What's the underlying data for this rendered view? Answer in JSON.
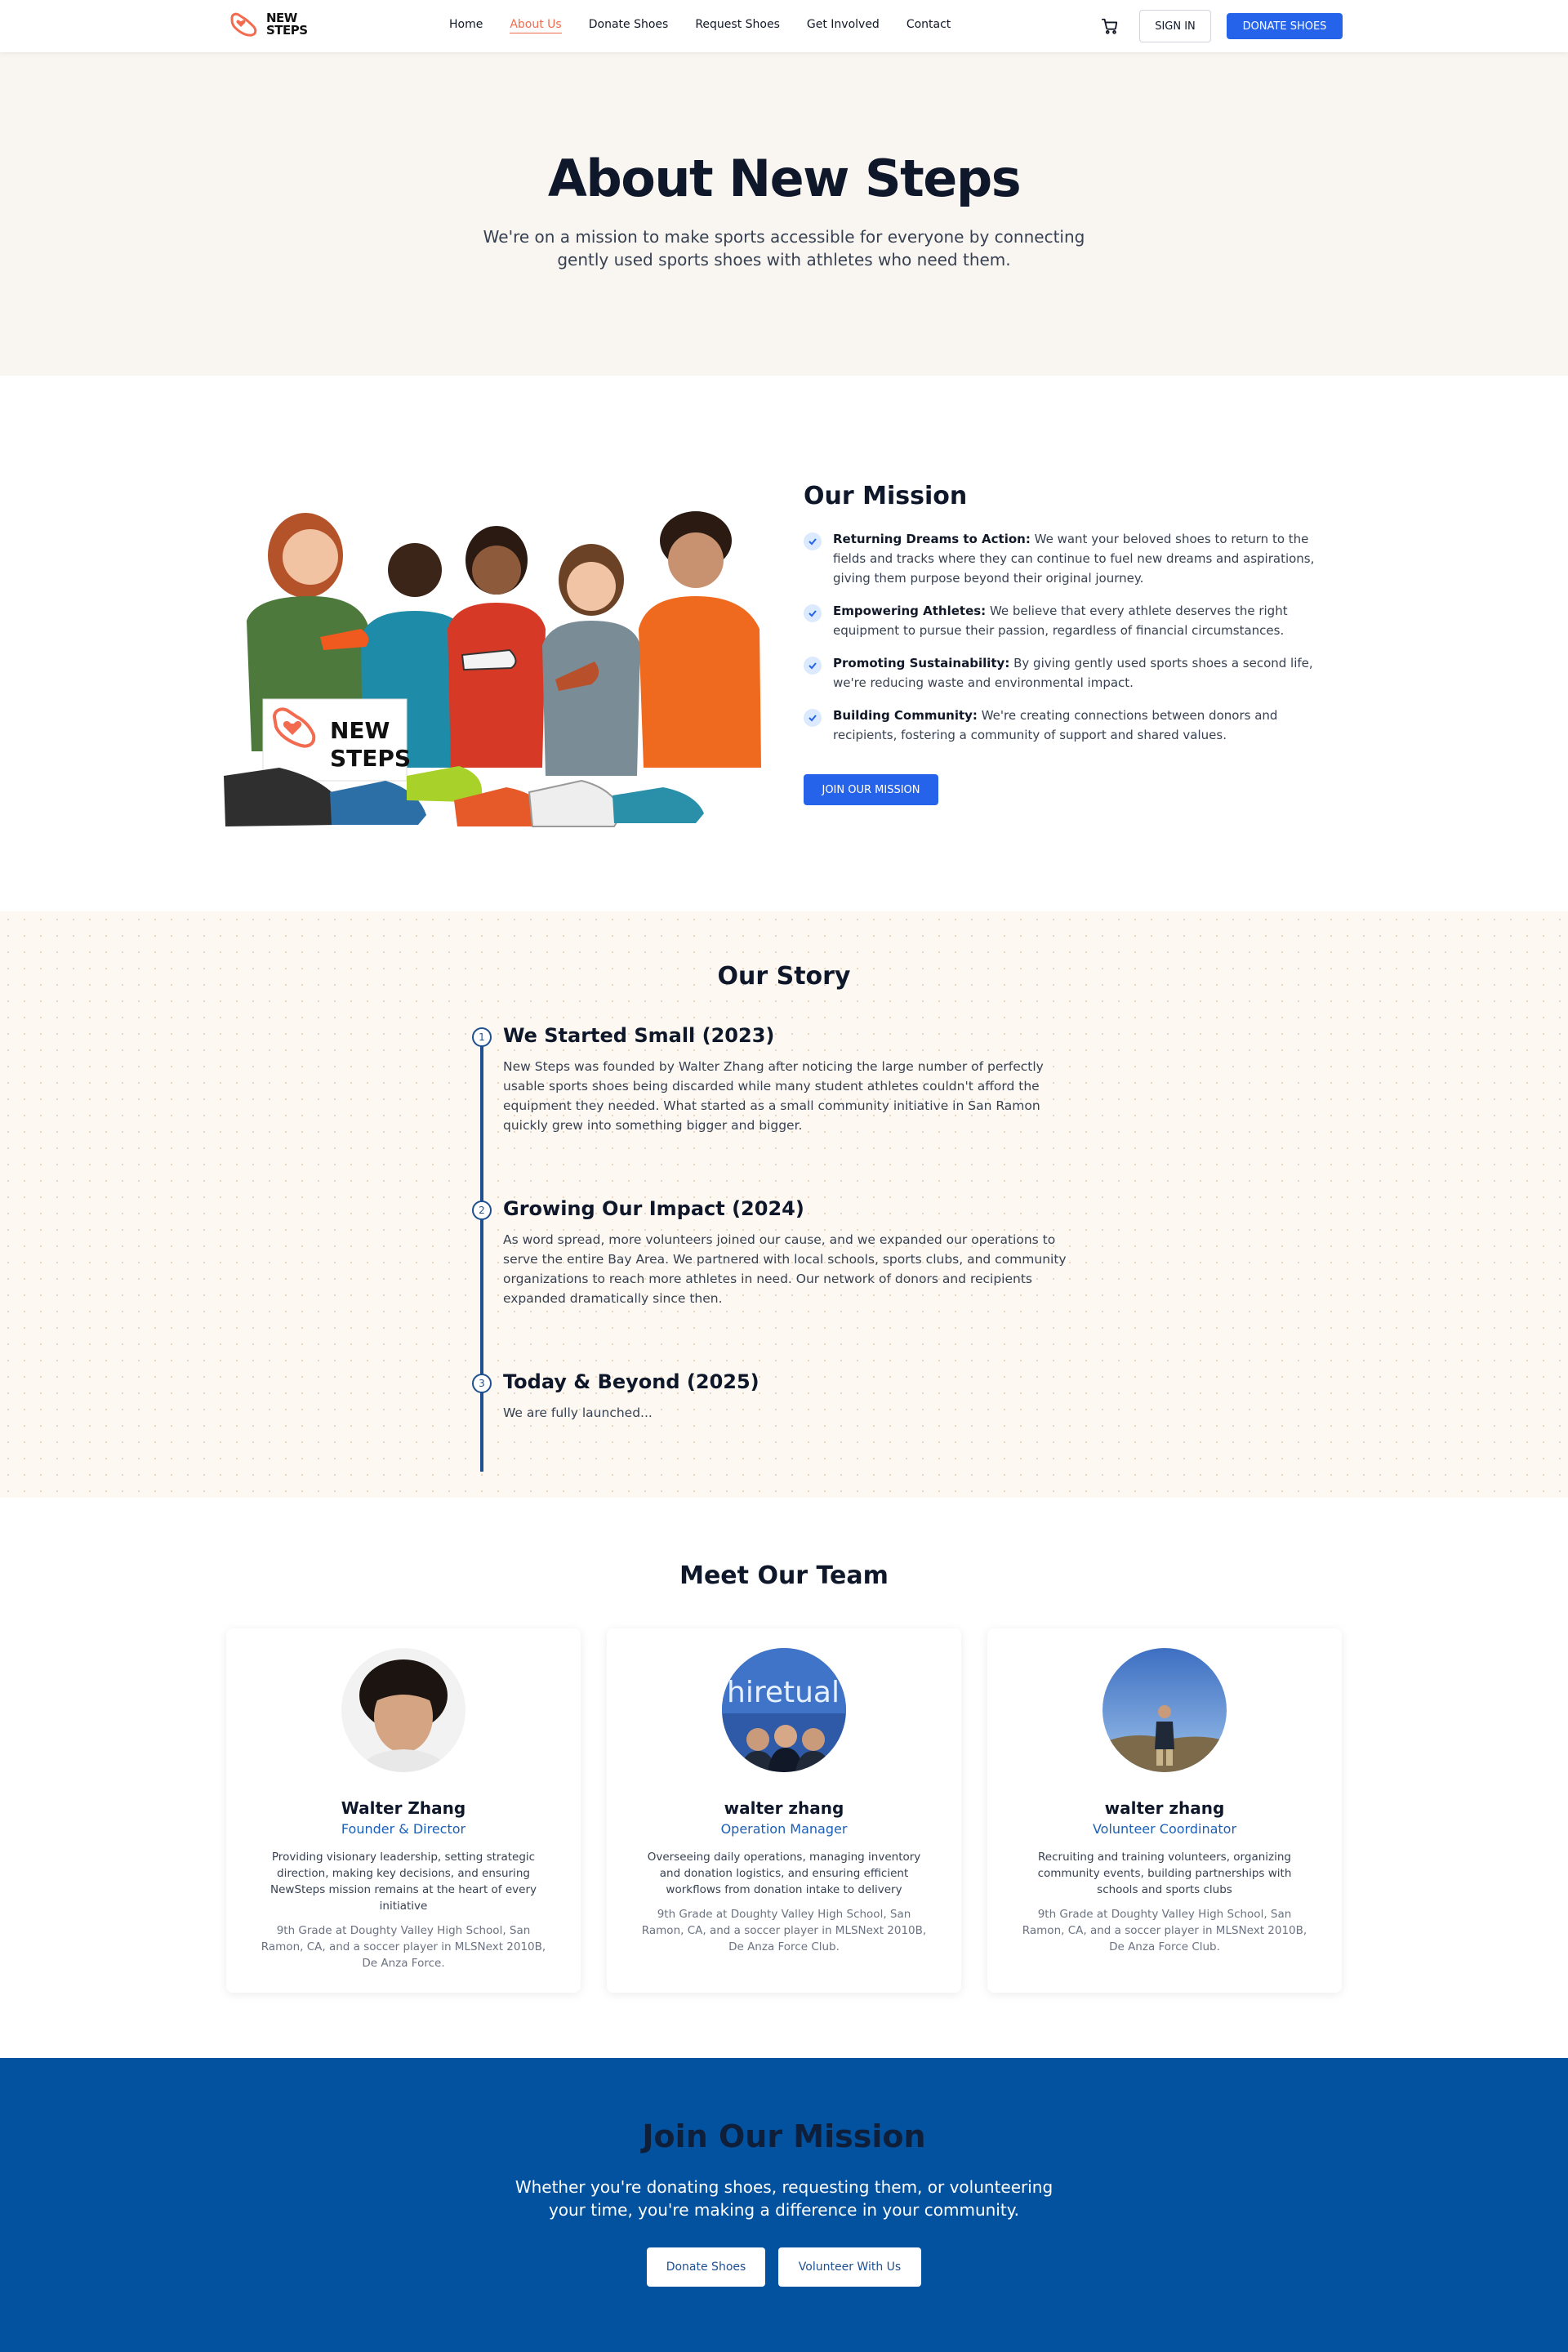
{
  "nav": {
    "logo_line1": "NEW",
    "logo_line2": "STEPS",
    "links": [
      "Home",
      "About Us",
      "Donate Shoes",
      "Request Shoes",
      "Get Involved",
      "Contact"
    ],
    "active_link": "About Us",
    "cart_icon": "cart-icon",
    "sign_in": "SIGN IN",
    "donate": "DONATE SHOES",
    "accent_color": "#2563eb",
    "active_color": "#f26b4e"
  },
  "hero": {
    "title": "About New Steps",
    "subtitle": "We're on a mission to make sports accessible for everyone by connecting gently used sports shoes with athletes who need them."
  },
  "mission": {
    "image_sign_line1": "NEW",
    "image_sign_line2": "STEPS",
    "title": "Our Mission",
    "items": [
      {
        "label": "Returning Dreams to Action:",
        "text": " We want your beloved shoes to return to the fields and tracks where they can continue to fuel new dreams and aspirations, giving them purpose beyond their original journey."
      },
      {
        "label": "Empowering Athletes:",
        "text": " We believe that every athlete deserves the right equipment to pursue their passion, regardless of financial circumstances."
      },
      {
        "label": "Promoting Sustainability:",
        "text": " By giving gently used sports shoes a second life, we're reducing waste and environmental impact."
      },
      {
        "label": "Building Community:",
        "text": " We're creating connections between donors and recipients, fostering a community of support and shared values."
      }
    ],
    "button": "JOIN OUR MISSION"
  },
  "story": {
    "title": "Our Story",
    "items": [
      {
        "num": "1",
        "title": "We Started Small (2023)",
        "body": "New Steps was founded by Walter Zhang after noticing the large number of perfectly usable sports shoes being discarded while many student athletes couldn't afford the equipment they needed. What started as a small community initiative in San Ramon quickly grew into something bigger and bigger."
      },
      {
        "num": "2",
        "title": "Growing Our Impact (2024)",
        "body": "As word spread, more volunteers joined our cause, and we expanded our operations to serve the entire Bay Area. We partnered with local schools, sports clubs, and community organizations to reach more athletes in need. Our network of donors and recipients expanded dramatically since then."
      },
      {
        "num": "3",
        "title": "Today & Beyond (2025)",
        "body": "We are fully launched..."
      }
    ]
  },
  "team": {
    "title": "Meet Our Team",
    "members": [
      {
        "name": "Walter Zhang",
        "role": "Founder & Director",
        "desc": "Providing visionary leadership, setting strategic direction, making key decisions, and ensuring NewSteps mission remains at the heart of every initiative",
        "bio": "9th Grade at Doughty Valley High School, San Ramon, CA, and a soccer player in MLSNext 2010B, De Anza Force."
      },
      {
        "name": "walter zhang",
        "role": "Operation Manager",
        "desc": "Overseeing daily operations, managing inventory and donation logistics, and ensuring efficient workflows from donation intake to delivery",
        "bio": "9th Grade at Doughty Valley High School, San Ramon, CA, and a soccer player in MLSNext 2010B, De Anza Force Club.",
        "photo_text": "hiretual"
      },
      {
        "name": "walter zhang",
        "role": "Volunteer Coordinator",
        "desc": "Recruiting and training volunteers, organizing community events, building partnerships with schools and sports clubs",
        "bio": "9th Grade at Doughty Valley High School, San Ramon, CA, and a soccer player in MLSNext 2010B, De Anza Force Club."
      }
    ]
  },
  "cta": {
    "title": "Join Our Mission",
    "text": "Whether you're donating shoes, requesting them, or volunteering your time, you're making a difference in your community.",
    "button1": "Donate Shoes",
    "button2": "Volunteer With Us",
    "bg_color": "#0252a0"
  }
}
